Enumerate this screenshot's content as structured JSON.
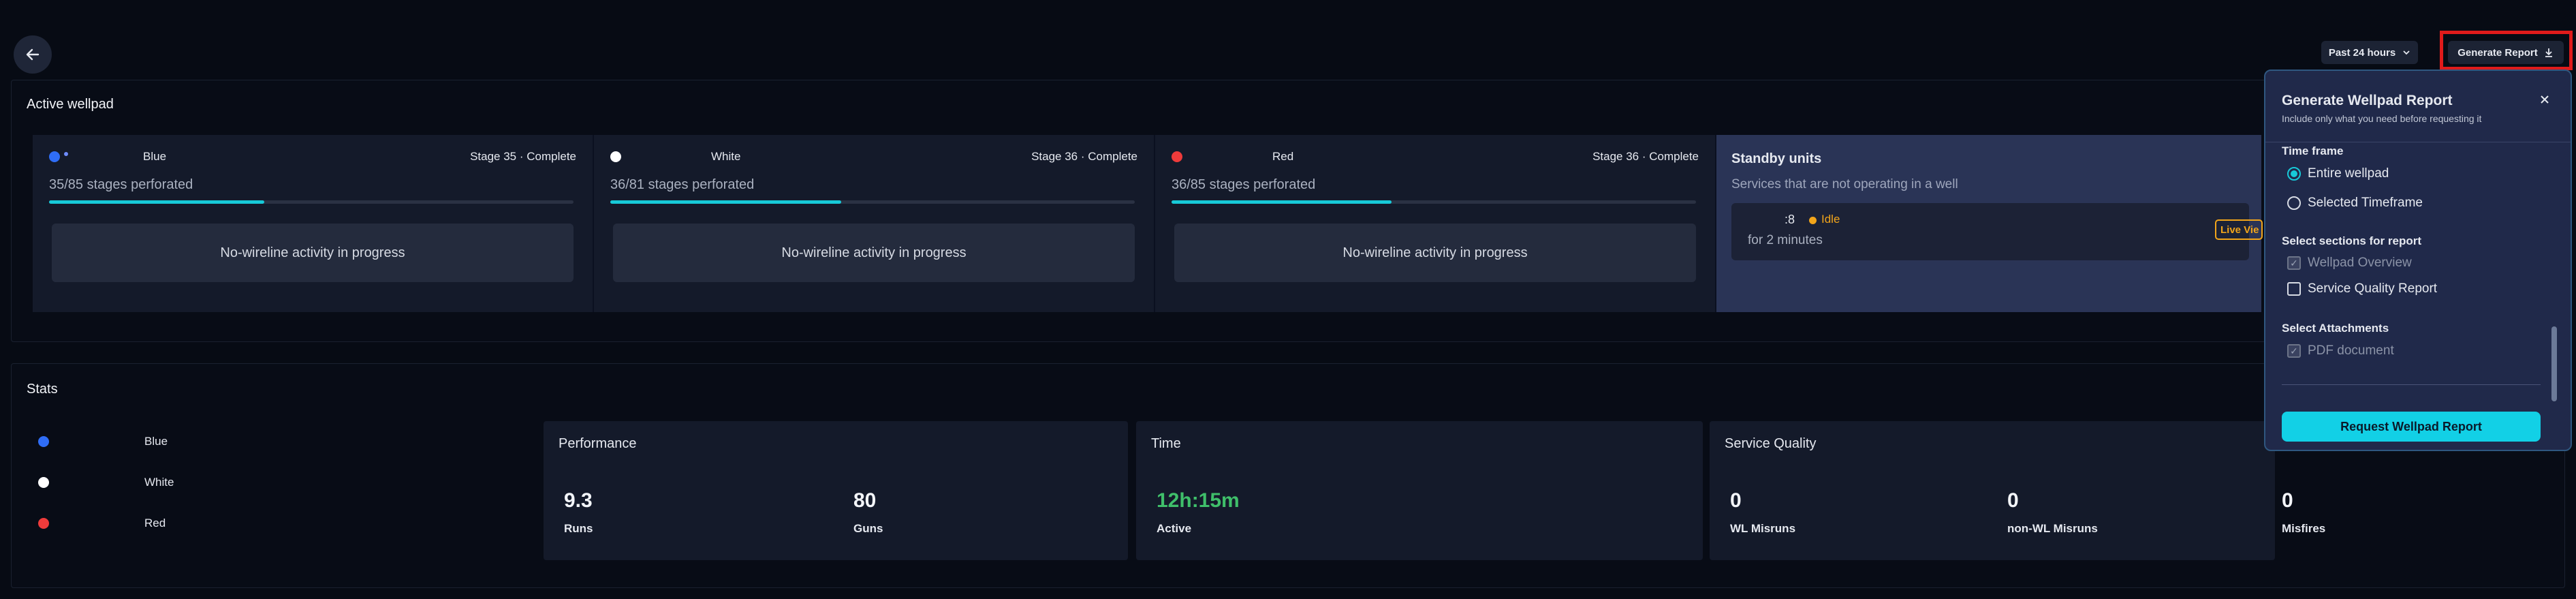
{
  "header": {
    "time_range_label": "Past 24 hours",
    "generate_report_label": "Generate Report"
  },
  "active_wellpad": {
    "title": "Active wellpad",
    "wells": [
      {
        "name": "Blue",
        "stage_status": "Stage 35 · Complete",
        "stages_text": "35/85 stages perforated",
        "progress": 0.41,
        "activity": "No-wireline activity in progress",
        "color": "#2f6df6"
      },
      {
        "name": "White",
        "stage_status": "Stage 36 · Complete",
        "stages_text": "36/81 stages perforated",
        "progress": 0.44,
        "activity": "No-wireline activity in progress",
        "color": "#ffffff"
      },
      {
        "name": "Red",
        "stage_status": "Stage 36 · Complete",
        "stages_text": "36/85 stages perforated",
        "progress": 0.42,
        "activity": "No-wireline activity in progress",
        "color": "#ee3b3b"
      }
    ],
    "standby": {
      "title": "Standby units",
      "subtitle": "Services that are not operating in a well",
      "unit_id": ":8",
      "unit_status": "Idle",
      "unit_duration": "for 2 minutes",
      "live_view_label": "Live Vie"
    }
  },
  "stats": {
    "title": "Stats",
    "legend": [
      {
        "label": "Blue",
        "color": "#2f6df6"
      },
      {
        "label": "White",
        "color": "#ffffff"
      },
      {
        "label": "Red",
        "color": "#ee3b3b"
      }
    ],
    "performance": {
      "title": "Performance",
      "runs_value": "9.3",
      "runs_label": "Runs",
      "guns_value": "80",
      "guns_label": "Guns"
    },
    "time": {
      "title": "Time",
      "active_value": "12h:15m",
      "active_label": "Active"
    },
    "service_quality": {
      "title": "Service Quality",
      "items": [
        {
          "value": "0",
          "label": "WL Misruns"
        },
        {
          "value": "0",
          "label": "non-WL Misruns"
        },
        {
          "value": "0",
          "label": "Misfires"
        }
      ]
    }
  },
  "report_popover": {
    "title": "Generate Wellpad Report",
    "subtitle": "Include only what you need before requesting it",
    "timeframe_heading": "Time frame",
    "timeframe_options": [
      "Entire wellpad",
      "Selected Timeframe"
    ],
    "sections_heading": "Select sections for report",
    "section_options": [
      "Wellpad Overview",
      "Service Quality Report"
    ],
    "attachments_heading": "Select Attachments",
    "attachment_options": [
      "PDF document"
    ],
    "request_button": "Request Wellpad Report"
  },
  "colors": {
    "accent": "#17c9d8",
    "idle": "#f2a51a",
    "time_active": "#3fbf6a",
    "highlight_border": "#e01b1b"
  }
}
